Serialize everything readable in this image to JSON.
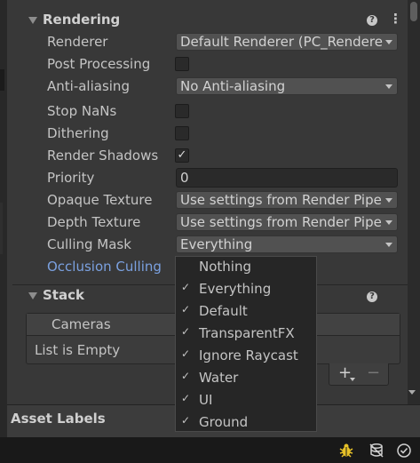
{
  "rendering": {
    "title": "Rendering",
    "rows": [
      {
        "label": "Renderer",
        "value": "Default Renderer (PC_Renderer)"
      },
      {
        "label": "Post Processing"
      },
      {
        "label": "Anti-aliasing",
        "value": "No Anti-aliasing"
      },
      {
        "label": "Stop NaNs"
      },
      {
        "label": "Dithering"
      },
      {
        "label": "Render Shadows",
        "check_glyph": "✓"
      },
      {
        "label": "Priority",
        "value": "0"
      },
      {
        "label": "Opaque Texture",
        "value": "Use settings from Render Pipeline"
      },
      {
        "label": "Depth Texture",
        "value": "Use settings from Render Pipeline"
      },
      {
        "label": "Culling Mask",
        "value": "Everything"
      },
      {
        "label": "Occlusion Culling"
      }
    ]
  },
  "stack": {
    "title": "Stack",
    "list_header": "Cameras",
    "empty_text": "List is Empty",
    "add_glyph": "+",
    "remove_glyph": "−"
  },
  "asset_labels": "Asset Labels",
  "help_glyph": "?",
  "menu_glyph": "⋮",
  "culling_menu": {
    "check_glyph": "✓",
    "items": [
      {
        "label": "Nothing",
        "checked": false
      },
      {
        "label": "Everything",
        "checked": true
      },
      {
        "label": "Default",
        "checked": true
      },
      {
        "label": "TransparentFX",
        "checked": true
      },
      {
        "label": "Ignore Raycast",
        "checked": true
      },
      {
        "label": "Water",
        "checked": true
      },
      {
        "label": "UI",
        "checked": true
      },
      {
        "label": "Ground",
        "checked": true
      }
    ]
  },
  "icons": {
    "section_menu": "kebab-icon",
    "help": "help-icon",
    "status_bar": [
      "bug-icon",
      "cache-server-icon",
      "check-circle-icon"
    ]
  },
  "colors": {
    "background": "#383838",
    "link": "#7ba1e0",
    "status_warning": "#e8c228"
  }
}
